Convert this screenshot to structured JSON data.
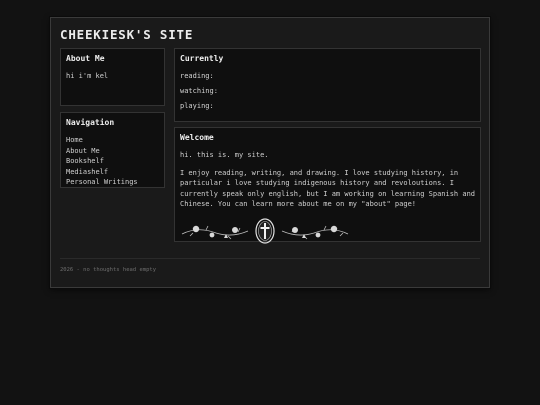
{
  "site": {
    "title": "CHEEKIESK'S SITE"
  },
  "about": {
    "heading": "About Me",
    "text": "hi i'm kel"
  },
  "navigation": {
    "heading": "Navigation",
    "items": [
      {
        "label": "Home"
      },
      {
        "label": "About Me"
      },
      {
        "label": "Bookshelf"
      },
      {
        "label": "Mediashelf"
      },
      {
        "label": "Personal Writings"
      }
    ]
  },
  "currently": {
    "heading": "Currently",
    "reading_label": "reading:",
    "watching_label": "watching:",
    "playing_label": "playing:"
  },
  "welcome": {
    "heading": "Welcome",
    "intro": "hi. this is. my site.",
    "body": "I enjoy reading, writing, and drawing. I love studying history, in particular i love studying indigenous history and revoloutions. I currently speak only english, but I am working on learning Spanish and Chinese. You can learn more about me on my \"about\" page!"
  },
  "footer": {
    "text": "2026 - no thoughts head empty"
  },
  "colors": {
    "background": "#121212",
    "panel": "#1a1a1a",
    "box": "#0f0f0f",
    "text": "#d0d0d0"
  }
}
